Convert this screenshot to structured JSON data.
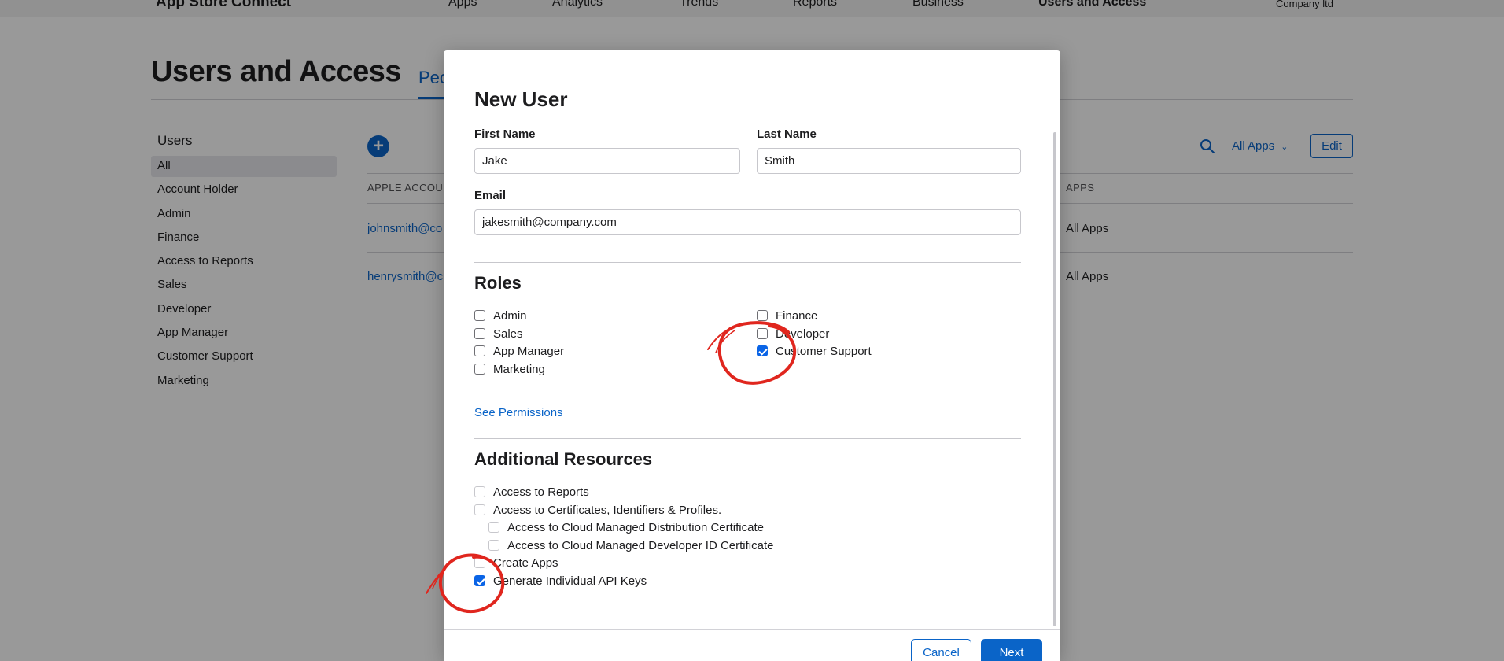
{
  "topnav": {
    "brand": "App Store Connect",
    "items": [
      "Apps",
      "Analytics",
      "Trends",
      "Reports",
      "Business",
      "Users and Access"
    ],
    "active": "Users and Access",
    "company": "Company ltd"
  },
  "page": {
    "title": "Users and Access",
    "tab_partial": "Peo"
  },
  "sidebar": {
    "heading": "Users",
    "items": [
      "All",
      "Account Holder",
      "Admin",
      "Finance",
      "Access to Reports",
      "Sales",
      "Developer",
      "App Manager",
      "Customer Support",
      "Marketing"
    ],
    "selected": "All"
  },
  "table": {
    "add_label": "+",
    "columns": [
      "APPLE ACCOU",
      "APPS"
    ],
    "rows": [
      {
        "email": "johnsmith@co",
        "apps": "All Apps"
      },
      {
        "email": "henrysmith@c",
        "apps": "All Apps"
      }
    ]
  },
  "toolbar": {
    "filter_label": "All Apps",
    "edit_label": "Edit"
  },
  "modal": {
    "title": "New User",
    "first_name": {
      "label": "First Name",
      "value": "Jake"
    },
    "last_name": {
      "label": "Last Name",
      "value": "Smith"
    },
    "email": {
      "label": "Email",
      "value": "jakesmith@company.com"
    },
    "roles_title": "Roles",
    "roles_left": [
      {
        "label": "Admin",
        "checked": false
      },
      {
        "label": "Sales",
        "checked": false
      },
      {
        "label": "App Manager",
        "checked": false
      },
      {
        "label": "Marketing",
        "checked": false
      }
    ],
    "roles_right": [
      {
        "label": "Finance",
        "checked": false
      },
      {
        "label": "Developer",
        "checked": false
      },
      {
        "label": "Customer Support",
        "checked": true
      }
    ],
    "see_permissions": "See Permissions",
    "additional_title": "Additional Resources",
    "resources": [
      {
        "label": "Access to Reports",
        "checked": false,
        "indent": false,
        "disabled": true
      },
      {
        "label": "Access to Certificates, Identifiers & Profiles.",
        "checked": false,
        "indent": false,
        "disabled": true
      },
      {
        "label": "Access to Cloud Managed Distribution Certificate",
        "checked": false,
        "indent": true,
        "disabled": true
      },
      {
        "label": "Access to Cloud Managed Developer ID Certificate",
        "checked": false,
        "indent": true,
        "disabled": true
      },
      {
        "label": "Create Apps",
        "checked": false,
        "indent": false,
        "disabled": true
      },
      {
        "label": "Generate Individual API Keys",
        "checked": true,
        "indent": false,
        "disabled": false
      }
    ],
    "cancel_label": "Cancel",
    "next_label": "Next"
  },
  "colors": {
    "accent": "#0a64c8",
    "checkbox_checked": "#0a64e6",
    "annotation": "#e0261e",
    "overlay": "rgba(0,0,0,0.4)"
  }
}
